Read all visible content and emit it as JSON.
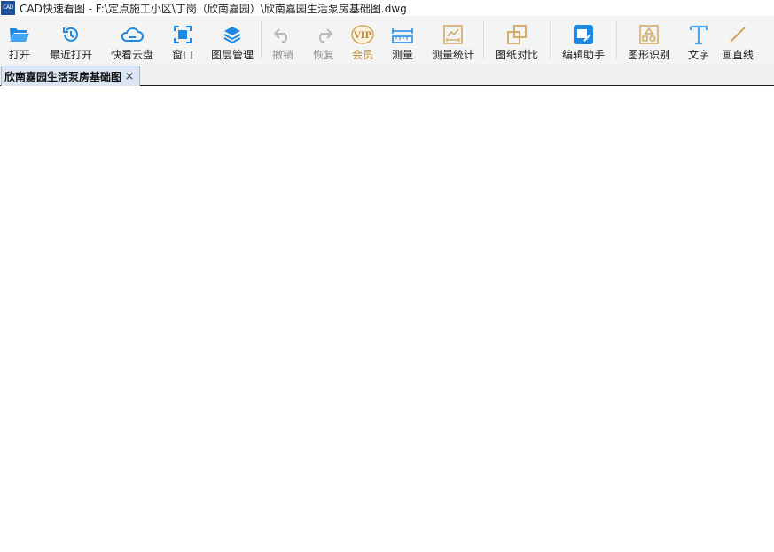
{
  "window": {
    "app_icon_text": "CAD",
    "title": "CAD快速看图 - F:\\定点施工小区\\丁岗（欣南嘉园）\\欣南嘉园生活泵房基础图.dwg"
  },
  "toolbar": {
    "open": "打开",
    "recent": "最近打开",
    "cloud": "快看云盘",
    "window": "窗口",
    "layers": "图层管理",
    "undo": "撤销",
    "redo": "恢复",
    "member": "会员",
    "measure": "测量",
    "measure_stats": "测量统计",
    "compare": "图纸对比",
    "edit_helper": "编辑助手",
    "shape_recognition": "图形识别",
    "text": "文字",
    "draw_line": "画直线"
  },
  "tabs": [
    {
      "label": "欣南嘉园生活泵房基础图",
      "close": "×"
    }
  ],
  "colors": {
    "accent_blue": "#1e88e5",
    "vip_gold": "#b8862f",
    "disabled_gray": "#b9b9b9",
    "icon_gold": "#d3a55a"
  },
  "icons": {
    "open": "folder-open-icon",
    "recent": "clock-history-icon",
    "cloud": "cloud-icon",
    "window": "window-frame-icon",
    "layers": "layers-icon",
    "undo": "undo-icon",
    "redo": "redo-icon",
    "member": "vip-icon",
    "measure": "ruler-icon",
    "measure_stats": "measure-stats-icon",
    "compare": "compare-icon",
    "edit_helper": "edit-helper-icon",
    "shape_recognition": "shape-recognition-icon",
    "text": "text-t-icon",
    "draw_line": "line-icon"
  }
}
